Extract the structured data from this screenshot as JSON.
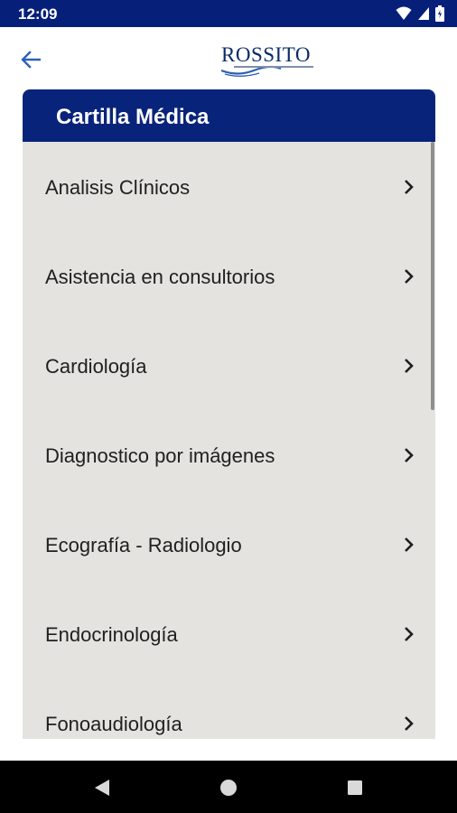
{
  "status_bar": {
    "time": "12:09",
    "icons": [
      "wifi-icon",
      "signal-icon",
      "battery-icon"
    ]
  },
  "app_bar": {
    "back_icon": "arrow-left-icon",
    "logo_text": "ROSSITO"
  },
  "card": {
    "title": "Cartilla Médica"
  },
  "list": {
    "items": [
      {
        "label": "Analisis Clínicos"
      },
      {
        "label": "Asistencia en consultorios"
      },
      {
        "label": "Cardiología"
      },
      {
        "label": "Diagnostico por imágenes"
      },
      {
        "label": "Ecografía - Radiologio"
      },
      {
        "label": "Endocrinología"
      },
      {
        "label": "Fonoaudiología"
      }
    ]
  },
  "nav_bar": {
    "icons": [
      "back-triangle-icon",
      "home-circle-icon",
      "recents-square-icon"
    ]
  },
  "colors": {
    "primary": "#08247a",
    "list_bg": "#e4e3e0",
    "back_arrow": "#2a63b8"
  }
}
